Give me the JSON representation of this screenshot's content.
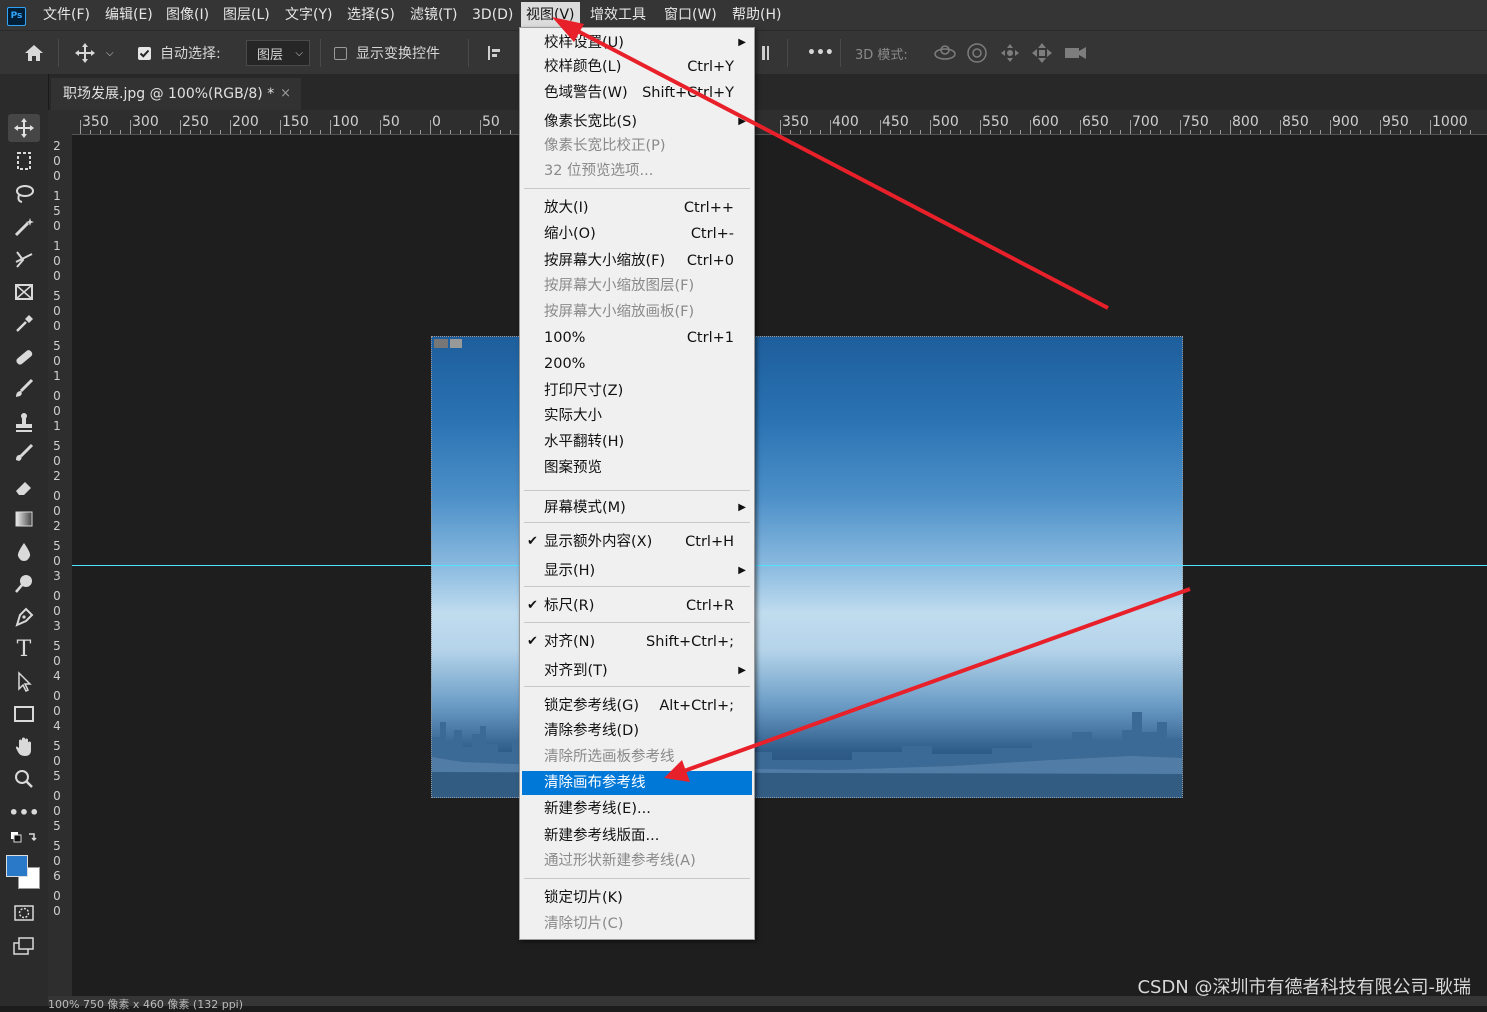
{
  "menubar": {
    "logo": "Ps",
    "items": [
      "文件(F)",
      "编辑(E)",
      "图像(I)",
      "图层(L)",
      "文字(Y)",
      "选择(S)",
      "滤镜(T)",
      "3D(D)",
      "视图(V)",
      "增效工具",
      "窗口(W)",
      "帮助(H)"
    ]
  },
  "options": {
    "auto_select_label": "自动选择:",
    "layer_select": "图层",
    "show_transform_label": "显示变换控件",
    "mode3d_label": "3D 模式:",
    "more": "•••"
  },
  "document": {
    "tab_title": "职场发展.jpg @ 100%(RGB/8) *",
    "tab_close": "×"
  },
  "ruler": {
    "h_labels": [
      "350",
      "300",
      "250",
      "200",
      "150",
      "100",
      "50",
      "0",
      "50",
      "350",
      "400",
      "450",
      "500",
      "550",
      "600",
      "650",
      "700",
      "750",
      "800",
      "850",
      "900",
      "950",
      "1000"
    ],
    "v_labels": [
      "2",
      "0",
      "0",
      "1",
      "5",
      "0",
      "1",
      "0",
      "0",
      "5",
      "0",
      "0",
      "5",
      "0",
      "1",
      "0",
      "0",
      "1",
      "5",
      "0",
      "2",
      "0",
      "0",
      "2",
      "5",
      "0",
      "3",
      "0",
      "0",
      "3",
      "5",
      "0",
      "4",
      "0",
      "0",
      "4",
      "5",
      "0",
      "5",
      "0",
      "0",
      "5",
      "5",
      "0",
      "6",
      "0",
      "0"
    ]
  },
  "view_menu": {
    "items": [
      {
        "label": "校样设置(U)",
        "shortcut": "",
        "submenu": true,
        "disabled": false
      },
      {
        "label": "校样颜色(L)",
        "shortcut": "Ctrl+Y",
        "disabled": false
      },
      {
        "label": "色域警告(W)",
        "shortcut": "Shift+Ctrl+Y",
        "disabled": false
      },
      {
        "label": "像素长宽比(S)",
        "shortcut": "",
        "submenu": true,
        "disabled": false
      },
      {
        "label": "像素长宽比校正(P)",
        "shortcut": "",
        "disabled": true
      },
      {
        "label": "32 位预览选项...",
        "shortcut": "",
        "disabled": true
      },
      {
        "label": "放大(I)",
        "shortcut": "Ctrl++",
        "disabled": false
      },
      {
        "label": "缩小(O)",
        "shortcut": "Ctrl+-",
        "disabled": false
      },
      {
        "label": "按屏幕大小缩放(F)",
        "shortcut": "Ctrl+0",
        "disabled": false
      },
      {
        "label": "按屏幕大小缩放图层(F)",
        "shortcut": "",
        "disabled": true
      },
      {
        "label": "按屏幕大小缩放画板(F)",
        "shortcut": "",
        "disabled": true
      },
      {
        "label": "100%",
        "shortcut": "Ctrl+1",
        "disabled": false
      },
      {
        "label": "200%",
        "shortcut": "",
        "disabled": false
      },
      {
        "label": "打印尺寸(Z)",
        "shortcut": "",
        "disabled": false
      },
      {
        "label": "实际大小",
        "shortcut": "",
        "disabled": false
      },
      {
        "label": "水平翻转(H)",
        "shortcut": "",
        "disabled": false
      },
      {
        "label": "图案预览",
        "shortcut": "",
        "disabled": false
      },
      {
        "label": "屏幕模式(M)",
        "shortcut": "",
        "submenu": true,
        "disabled": false
      },
      {
        "label": "显示额外内容(X)",
        "shortcut": "Ctrl+H",
        "checked": true,
        "disabled": false
      },
      {
        "label": "显示(H)",
        "shortcut": "",
        "submenu": true,
        "disabled": false
      },
      {
        "label": "标尺(R)",
        "shortcut": "Ctrl+R",
        "checked": true,
        "disabled": false
      },
      {
        "label": "对齐(N)",
        "shortcut": "Shift+Ctrl+;",
        "checked": true,
        "disabled": false
      },
      {
        "label": "对齐到(T)",
        "shortcut": "",
        "submenu": true,
        "disabled": false
      },
      {
        "label": "锁定参考线(G)",
        "shortcut": "Alt+Ctrl+;",
        "disabled": false
      },
      {
        "label": "清除参考线(D)",
        "shortcut": "",
        "disabled": false
      },
      {
        "label": "清除所选画板参考线",
        "shortcut": "",
        "disabled": true
      },
      {
        "label": "清除画布参考线",
        "shortcut": "",
        "highlighted": true,
        "disabled": false
      },
      {
        "label": "新建参考线(E)...",
        "shortcut": "",
        "disabled": false
      },
      {
        "label": "新建参考线版面...",
        "shortcut": "",
        "disabled": false
      },
      {
        "label": "通过形状新建参考线(A)",
        "shortcut": "",
        "disabled": true
      },
      {
        "label": "锁定切片(K)",
        "shortcut": "",
        "disabled": false
      },
      {
        "label": "清除切片(C)",
        "shortcut": "",
        "disabled": true
      }
    ]
  },
  "status": {
    "text": "100%     750 像素 x 460 像素 (132 ppi)"
  },
  "watermark": "CSDN @深圳市有德者科技有限公司-耿瑞",
  "colors": {
    "accent": "#0078d7",
    "guide": "#4fe3ff",
    "annotation_arrow": "#e8202a"
  }
}
